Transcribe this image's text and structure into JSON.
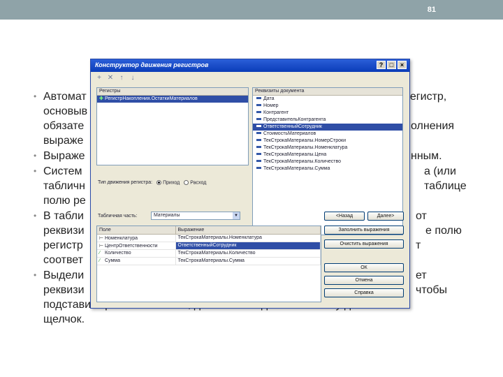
{
  "slide": {
    "number": "81"
  },
  "bullets": [
    {
      "visible_text": "Автоматически",
      "tail": "регистр, основываясь на ..."
    },
    {
      "visible_text": "Выражение"
    },
    {
      "visible_text": "Система"
    },
    {
      "visible_text": "В таблице"
    },
    {
      "visible_text": "Выделите",
      "tail": "подставить реквизит в поле, достаточно сделать по нему двойной щелчок."
    }
  ],
  "bullet_texts": {
    "b1_l1_start": "Автомат",
    "b1_l1_end": "регистр,",
    "b1_l2": "основыв",
    "b1_l3_start": "обязате",
    "b1_l3_end": "олнения",
    "b1_l4": "выраже",
    "b2_start": "Выраже",
    "b2_end": "нным.",
    "b3_l1_start": "Систем",
    "b3_l1_end": "а (или",
    "b3_l2_start": "табличн",
    "b3_l2_end": "таблице",
    "b3_l3": "полю ре",
    "b4_l1_start": "В табли",
    "b4_l1_end": "от",
    "b4_l2_start": "реквизи",
    "b4_l2_end": "е полю",
    "b4_l3_start": "регистр",
    "b4_l3_end": "т",
    "b4_l4": "соответ",
    "b5_l1_start": "Выдели",
    "b5_l1_end": "ет",
    "b5_l2_start": "реквизи",
    "b5_l2_end": "чтобы",
    "b5_l3": "подставить реквизит в поле, достаточно сделать по нему двойной",
    "b5_l4": "щелчок."
  },
  "dialog": {
    "title": "Конструктор движения регистров",
    "registers_header": "Регистры",
    "register_item": "РегистрНакопления.ОстаткиМатериалов",
    "doc_requisites_header": "Реквизиты документа",
    "doc_requisites": [
      "Дата",
      "Номер",
      "Контрагент",
      "ПредставительКонтрагента",
      "ОтветственныйСотрудник",
      "СтоимостьМатериалов",
      "ТекСтрокаМатериалы.НомерСтроки",
      "ТекСтрокаМатериалы.Номенклатура",
      "ТекСтрокаМатериалы.Цена",
      "ТекСтрокаМатериалы.Количество",
      "ТекСтрокаМатериалы.Сумма"
    ],
    "selected_requisite_index": 4,
    "movement_type_label": "Тип движения регистра:",
    "radio_income": "Приход",
    "radio_expense": "Расход",
    "radio_selected": "Приход",
    "tabular_part_label": "Табличная часть:",
    "tabular_part_value": "Материалы",
    "grid_headers": [
      "Поле",
      "Выражение"
    ],
    "grid_rows": [
      {
        "field": "Номенклатура",
        "expr": "ТекСтрокаМатериалы.Номенклатура"
      },
      {
        "field": "ЦентрОтветственности",
        "expr": "ОтветственныйСотрудник"
      },
      {
        "field": "Количество",
        "expr": "ТекСтрокаМатериалы.Количество"
      },
      {
        "field": "Сумма",
        "expr": "ТекСтрокаМатериалы.Сумма"
      }
    ],
    "buttons": {
      "back": "<Назад",
      "next": "Далее>",
      "fill": "Заполнить выражения",
      "clear": "Очистить выражения",
      "ok": "ОК",
      "cancel": "Отмена",
      "help": "Справка"
    }
  }
}
